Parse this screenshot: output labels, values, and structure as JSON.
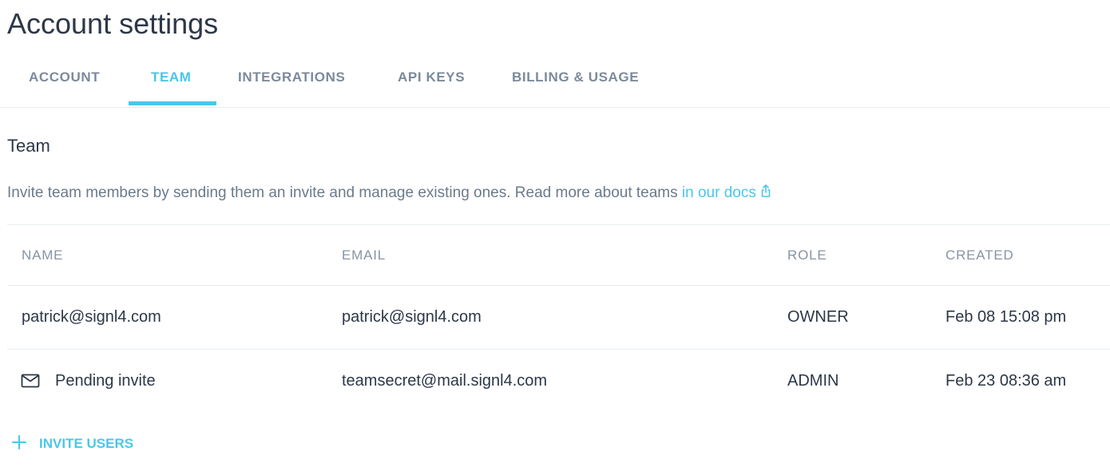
{
  "page_title": "Account settings",
  "tabs": [
    {
      "label": "ACCOUNT",
      "active": false
    },
    {
      "label": "TEAM",
      "active": true
    },
    {
      "label": "INTEGRATIONS",
      "active": false
    },
    {
      "label": "API KEYS",
      "active": false
    },
    {
      "label": "BILLING & USAGE",
      "active": false
    }
  ],
  "team": {
    "title": "Team",
    "description": "Invite team members by sending them an invite and manage existing ones. Read more about teams ",
    "docs_link": "in our docs",
    "columns": [
      "NAME",
      "EMAIL",
      "ROLE",
      "CREATED"
    ],
    "rows": [
      {
        "name": "patrick@signl4.com",
        "email": "patrick@signl4.com",
        "role": "OWNER",
        "created": "Feb 08 15:08 pm",
        "pending": false
      },
      {
        "name": "Pending invite",
        "email": "teamsecret@mail.signl4.com",
        "role": "ADMIN",
        "created": "Feb 23 08:36 am",
        "pending": true
      }
    ],
    "invite_button": "INVITE USERS"
  },
  "colors": {
    "accent": "#4bc6e9",
    "text": "#2d3748",
    "muted": "#7b8a9c",
    "divider": "#e8edf2"
  },
  "icons": {
    "external_link": "external-link-icon",
    "pending_invite": "mail-icon",
    "invite": "plus-icon"
  }
}
